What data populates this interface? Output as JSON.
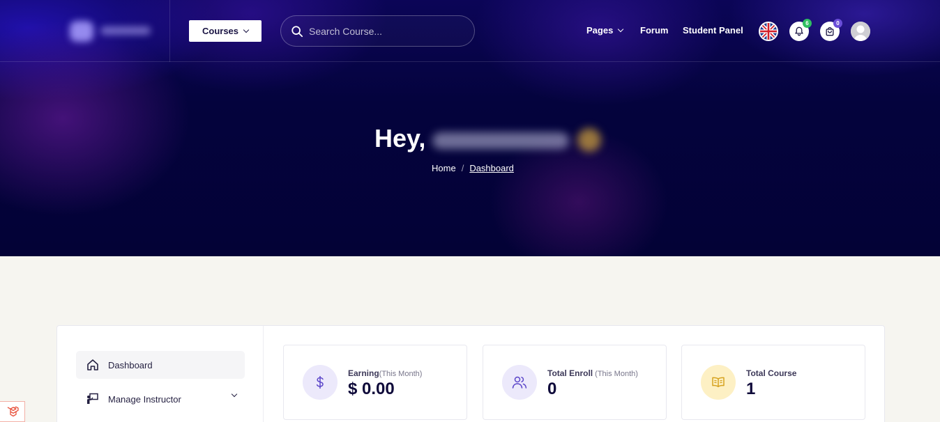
{
  "header": {
    "courses_label": "Courses",
    "search_placeholder": "Search Course...",
    "nav": {
      "pages": "Pages",
      "forum": "Forum",
      "student_panel": "Student Panel"
    },
    "notification_count": "6",
    "cart_count": "0"
  },
  "hero": {
    "greeting": "Hey,",
    "breadcrumb": {
      "home": "Home",
      "separator": "/",
      "current": "Dashboard"
    }
  },
  "sidebar": {
    "items": [
      {
        "label": "Dashboard",
        "icon": "home-icon"
      },
      {
        "label": "Manage Instructor",
        "icon": "instructor-icon"
      }
    ]
  },
  "stats": [
    {
      "label": "Earning",
      "sub": "(This Month)",
      "value": "$ 0.00",
      "icon": "dollar-icon"
    },
    {
      "label": "Total Enroll",
      "sub": " (This Month)",
      "value": "0",
      "icon": "users-icon"
    },
    {
      "label": "Total Course",
      "sub": "",
      "value": "1",
      "icon": "book-icon"
    }
  ],
  "colors": {
    "hero_dark": "#030236",
    "accent_purple": "#6a4ed8",
    "badge_green": "#2fbf62",
    "earning_icon_bg": "#ece9fb",
    "course_icon_bg": "#fdf0c4",
    "text_dark": "#0f0a3a"
  }
}
